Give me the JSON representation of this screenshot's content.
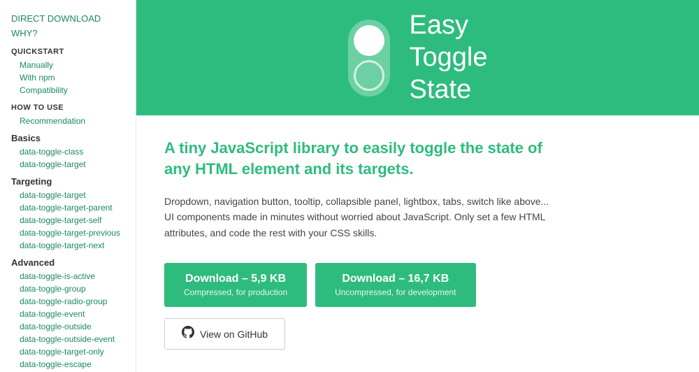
{
  "sidebar": {
    "sections": [
      {
        "type": "link",
        "label": "DIRECT DOWNLOAD",
        "level": "top"
      },
      {
        "type": "link",
        "label": "WHY?",
        "level": "top"
      },
      {
        "type": "header",
        "label": "QUICKSTART"
      },
      {
        "type": "link",
        "label": "Manually",
        "level": "sub"
      },
      {
        "type": "link",
        "label": "With npm",
        "level": "sub"
      },
      {
        "type": "link",
        "label": "Compatibility",
        "level": "sub"
      },
      {
        "type": "header",
        "label": "HOW TO USE"
      },
      {
        "type": "link",
        "label": "Recommendation",
        "level": "sub"
      },
      {
        "type": "category",
        "label": "Basics"
      },
      {
        "type": "link",
        "label": "data-toggle-class",
        "level": "deep"
      },
      {
        "type": "link",
        "label": "data-toggle-target",
        "level": "deep"
      },
      {
        "type": "category",
        "label": "Targeting"
      },
      {
        "type": "link",
        "label": "data-toggle-target",
        "level": "deep"
      },
      {
        "type": "link",
        "label": "data-toggle-target-parent",
        "level": "deep"
      },
      {
        "type": "link",
        "label": "data-toggle-target-self",
        "level": "deep"
      },
      {
        "type": "link",
        "label": "data-toggle-target-previous",
        "level": "deep"
      },
      {
        "type": "link",
        "label": "data-toggle-target-next",
        "level": "deep"
      },
      {
        "type": "category",
        "label": "Advanced"
      },
      {
        "type": "link",
        "label": "data-toggle-is-active",
        "level": "deep"
      },
      {
        "type": "link",
        "label": "data-toggle-group",
        "level": "deep"
      },
      {
        "type": "link",
        "label": "data-toggle-radio-group",
        "level": "deep"
      },
      {
        "type": "link",
        "label": "data-toggle-event",
        "level": "deep"
      },
      {
        "type": "link",
        "label": "data-toggle-outside",
        "level": "deep"
      },
      {
        "type": "link",
        "label": "data-toggle-outside-event",
        "level": "deep"
      },
      {
        "type": "link",
        "label": "data-toggle-target-only",
        "level": "deep"
      },
      {
        "type": "link",
        "label": "data-toggle-escape",
        "level": "deep"
      }
    ]
  },
  "hero": {
    "title_line1": "Easy",
    "title_line2": "Toggle",
    "title_line3": "State"
  },
  "content": {
    "tagline": "A tiny JavaScript library to easily toggle the state of any HTML element and its targets.",
    "description_line1": "Dropdown, navigation button, tooltip, collapsible panel, lightbox, tabs, switch like above...",
    "description_line2": "UI components made in minutes without worried about JavaScript. Only set a few HTML attributes, and code the rest with your CSS skills.",
    "btn_download1_label": "Download – 5,9 KB",
    "btn_download1_sub": "Compressed, for production",
    "btn_download2_label": "Download – 16,7 KB",
    "btn_download2_sub": "Uncompressed, for development",
    "btn_github_label": "View on GitHub"
  }
}
